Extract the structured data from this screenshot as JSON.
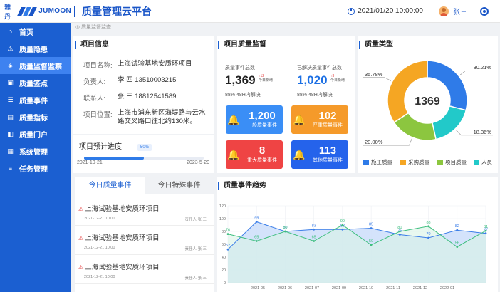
{
  "header": {
    "logo_cn": "雅丹",
    "logo_en": "JUMOON",
    "title": "质量管理云平台",
    "datetime": "2021/01/20  10:00:00",
    "user": "张三",
    "clock_icon": "clock-icon",
    "settings_icon": "gear-icon"
  },
  "sidebar": {
    "items": [
      {
        "label": "首页",
        "icon": "⌂"
      },
      {
        "label": "质量隐患",
        "icon": "⚠"
      },
      {
        "label": "质量监督监察",
        "icon": "◈"
      },
      {
        "label": "质量签点",
        "icon": "▣"
      },
      {
        "label": "质量事件",
        "icon": "☰"
      },
      {
        "label": "质量指标",
        "icon": "▤"
      },
      {
        "label": "质量门户",
        "icon": "◧"
      },
      {
        "label": "系统管理",
        "icon": "▦"
      },
      {
        "label": "任务管理",
        "icon": "≡"
      }
    ],
    "active_index": 2,
    "active_color": "#3e82f0",
    "bg_color": "#1b5fd1"
  },
  "breadcrumb": "◎ 质量监督监查",
  "project": {
    "title": "项目信息",
    "name_label": "项目名称:",
    "name": "上海试验基地安质环项目",
    "owner_label": "负责人:",
    "owner": "李 四  13510003215",
    "contact_label": "联系人:",
    "contact": "张 三  18812541589",
    "location_label": "项目位置:",
    "location": "上海市浦东新区海堤路与云水路交叉路口往北约130米。",
    "progress_title": "项目预计进度",
    "progress_value": 0.5,
    "progress_text": "50%",
    "start_date": "2021-10-21",
    "end_date": "2023-5-20"
  },
  "monitor": {
    "title": "项目质量监督",
    "total_label": "质量事件总数",
    "total": "1,369",
    "total_delta": "↑12",
    "total_delta_label": "今日新增",
    "total_sub": "88%  48H内解决",
    "resolved_label": "已解决质量事件总数",
    "resolved": "1,020",
    "resolved_delta": "↑3",
    "resolved_delta_label": "今日新增",
    "resolved_sub": "88%  48H内解决",
    "cards": [
      {
        "num": "1,200",
        "label": "一般质量事件",
        "color": "#3a8ef6"
      },
      {
        "num": "102",
        "label": "严重质量事件",
        "color": "#f59a2a"
      },
      {
        "num": "8",
        "label": "重大质量事件",
        "color": "#ef4444"
      },
      {
        "num": "113",
        "label": "其他质量事件",
        "color": "#2563eb"
      }
    ]
  },
  "types": {
    "title": "质量类型",
    "center_value": "1369",
    "slices": [
      {
        "name": "施工质量",
        "pct": 30.21,
        "label": "30.21%",
        "color": "#2f7be8"
      },
      {
        "name": "人员",
        "pct": 18.36,
        "label": "18.36%",
        "color": "#22c9c9"
      },
      {
        "name": "项目质量",
        "pct": 20.0,
        "label": "20.00%",
        "color": "#8cc63f"
      },
      {
        "name": "采购质量",
        "pct": 35.78,
        "label": "35.78%",
        "color": "#f5a623"
      }
    ],
    "legend": [
      "施工质量",
      "采购质量",
      "项目质量",
      "人员"
    ]
  },
  "events": {
    "tabs": [
      "今日质量事件",
      "今日特殊事件"
    ],
    "active_tab": 0,
    "items": [
      {
        "title": "上海试验基地安质环项目",
        "date": "2021-12-21  10:00",
        "owner": "责任人:张 三"
      },
      {
        "title": "上海试验基地安质环项目",
        "date": "2021-12-21  10:00",
        "owner": "责任人:张 三"
      },
      {
        "title": "上海试验基地安质环项目",
        "date": "2021-12-21  10:00",
        "owner": "责任人:张 三"
      }
    ]
  },
  "chart_data": {
    "type": "area",
    "title": "质量事件趋势",
    "categories": [
      "2021-05",
      "2021-06",
      "2021-07",
      "2021-09",
      "2021-10",
      "2021-11",
      "2021-12",
      "2022-01"
    ],
    "y_ticks": [
      0,
      20,
      40,
      60,
      80,
      100,
      120
    ],
    "ylim": [
      0,
      120
    ],
    "series": [
      {
        "color": "#3a7de8",
        "fill": "#cfe0fb",
        "values": [
          52,
          95,
          80,
          83,
          83,
          85,
          75,
          70,
          82,
          77
        ],
        "x_positions": [
          0,
          1,
          2,
          3,
          4,
          5,
          6,
          7,
          8,
          9
        ],
        "labels": [
          "52",
          "95",
          "80",
          "83",
          "83",
          "85",
          "75",
          "70",
          "82",
          "77"
        ]
      },
      {
        "color": "#3fbf7f",
        "fill": "#d8f3e6",
        "values": [
          76,
          65,
          80,
          65,
          90,
          59,
          80,
          88,
          56,
          81
        ],
        "x_positions": [
          0,
          1,
          2,
          3,
          4,
          5,
          6,
          7,
          8,
          9
        ],
        "labels": [
          "76",
          "65",
          "80",
          "65",
          "90",
          "59",
          "80",
          "88",
          "56",
          "81"
        ]
      }
    ],
    "grid": true
  }
}
